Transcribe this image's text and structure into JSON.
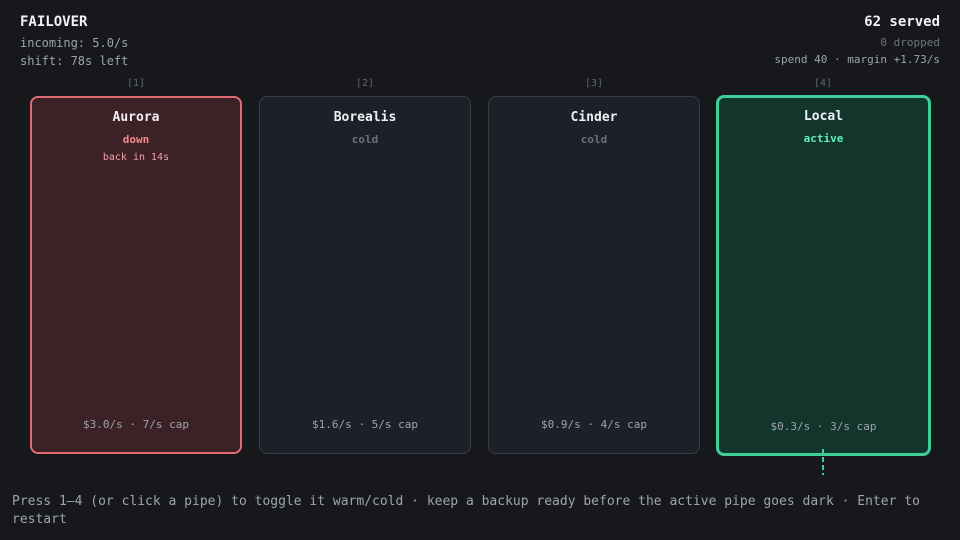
{
  "header": {
    "title": "FAILOVER",
    "incoming": "incoming: 5.0/s",
    "shift": "shift: 78s left",
    "served": "62 served",
    "dropped": "0 dropped",
    "spend": "spend 40 · margin +1.73/s"
  },
  "pipes": [
    {
      "index": "[1]",
      "name": "Aurora",
      "status": "down",
      "note": "back in 14s",
      "rate": "$3.0/s · 7/s cap"
    },
    {
      "index": "[2]",
      "name": "Borealis",
      "status": "cold",
      "note": "",
      "rate": "$1.6/s · 5/s cap"
    },
    {
      "index": "[3]",
      "name": "Cinder",
      "status": "cold",
      "note": "",
      "rate": "$0.9/s · 4/s cap"
    },
    {
      "index": "[4]",
      "name": "Local",
      "status": "active",
      "note": "",
      "rate": "$0.3/s · 3/s cap"
    }
  ],
  "help": "Press 1–4 (or click a pipe) to toggle it warm/cold · keep a backup ready before the active pipe goes dark · Enter to restart",
  "colors": {
    "background": "#17181c",
    "down": "#e06b72",
    "active": "#3ccf98",
    "cold": "#3a3d46"
  }
}
